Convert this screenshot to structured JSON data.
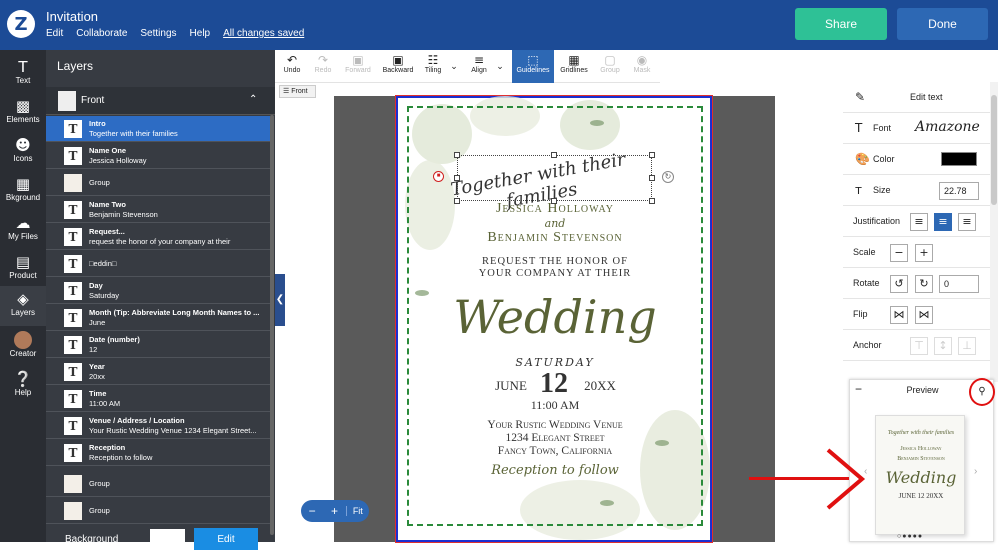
{
  "app": {
    "title": "Invitation",
    "menu": [
      "Edit",
      "Collaborate",
      "Settings",
      "Help"
    ],
    "saved_status": "All changes saved",
    "share_label": "Share",
    "done_label": "Done"
  },
  "leftnav": [
    {
      "label": "Text",
      "icon": "text-icon"
    },
    {
      "label": "Elements",
      "icon": "elements-icon"
    },
    {
      "label": "Icons",
      "icon": "smiley-icon"
    },
    {
      "label": "Bkground",
      "icon": "background-icon"
    },
    {
      "label": "My Files",
      "icon": "cloud-upload-icon"
    },
    {
      "label": "Product",
      "icon": "product-icon"
    },
    {
      "label": "Layers",
      "icon": "layers-icon"
    },
    {
      "label": "Creator",
      "icon": "avatar-icon"
    },
    {
      "label": "Help",
      "icon": "help-icon"
    }
  ],
  "layers_panel": {
    "title": "Layers",
    "front_label": "Front",
    "items": [
      {
        "name": "Intro",
        "sub": "Together with their families",
        "selected": true
      },
      {
        "name": "Name One",
        "sub": "Jessica Holloway"
      },
      {
        "name": "",
        "sub": "",
        "single": "Group"
      },
      {
        "name": "Name Two",
        "sub": "Benjamin Stevenson"
      },
      {
        "name": "Request...",
        "sub": "request the honor of your company at their"
      },
      {
        "name": "",
        "sub": "",
        "single": "□eddin□"
      },
      {
        "name": "Day",
        "sub": "Saturday"
      },
      {
        "name": "Month (Tip: Abbreviate Long Month Names to ...",
        "sub": "June"
      },
      {
        "name": "Date (number)",
        "sub": "12"
      },
      {
        "name": "Year",
        "sub": "20xx"
      },
      {
        "name": "Time",
        "sub": "11:00 AM"
      },
      {
        "name": "Venue / Address / Location",
        "sub": "Your Rustic Wedding Venue 1234 Elegant Street..."
      },
      {
        "name": "Reception",
        "sub": "Reception to follow"
      },
      {
        "name": "",
        "sub": "",
        "single": "Group"
      },
      {
        "name": "",
        "sub": "",
        "single": "Group"
      }
    ],
    "background_label": "Background",
    "edit_label": "Edit"
  },
  "toolbar": [
    {
      "label": "Undo",
      "icon": "undo-icon",
      "glyph": "↶"
    },
    {
      "label": "Redo",
      "icon": "redo-icon",
      "glyph": "↷",
      "disabled": true
    },
    {
      "label": "Forward",
      "icon": "forward-icon",
      "glyph": "▣",
      "disabled": true
    },
    {
      "label": "Backward",
      "icon": "backward-icon",
      "glyph": "▣"
    },
    {
      "label": "Tiling",
      "icon": "tiling-icon",
      "glyph": "☷"
    },
    {
      "label": "Align",
      "icon": "align-icon",
      "glyph": "≡"
    },
    {
      "label": "Guidelines",
      "icon": "guidelines-icon",
      "glyph": "⬚",
      "active": true
    },
    {
      "label": "Gridlines",
      "icon": "gridlines-icon",
      "glyph": "▦"
    },
    {
      "label": "Group",
      "icon": "group-icon",
      "glyph": "▢",
      "disabled": true
    },
    {
      "label": "Mask",
      "icon": "mask-icon",
      "glyph": "◉",
      "disabled": true
    }
  ],
  "front_tag": "Front",
  "card": {
    "intro": "Together with their families",
    "name_one": "Jessica Holloway",
    "and": "and",
    "name_two": "Benjamin Stevenson",
    "request_1": "Request the honor of",
    "request_2": "your company at their",
    "wedding": "Wedding",
    "day": "Saturday",
    "month": "June",
    "date": "12",
    "year": "20XX",
    "time": "11:00 AM",
    "venue_1": "Your Rustic Wedding Venue",
    "venue_2": "1234 Elegant Street",
    "venue_3": "Fancy Town, California",
    "reception": "Reception to follow"
  },
  "zoom": {
    "minus": "−",
    "plus": "+",
    "fit": "Fit"
  },
  "properties": {
    "edit_text": "Edit text",
    "font_label": "Font",
    "font_value": "Amazone",
    "color_label": "Color",
    "color_value": "#000000",
    "size_label": "Size",
    "size_value": "22.78",
    "justification_label": "Justification",
    "scale_label": "Scale",
    "rotate_label": "Rotate",
    "rotate_value": "0",
    "flip_label": "Flip",
    "anchor_label": "Anchor"
  },
  "preview": {
    "title": "Preview",
    "minimize": "−",
    "card_intro": "Together with their families",
    "card_name_one": "Jessica Holloway",
    "card_name_two": "Benjamin Stevenson",
    "card_wedding": "Wedding",
    "card_date": "JUNE 12 20XX"
  },
  "colors": {
    "topbar": "#1c4b96",
    "share": "#2ec196",
    "done": "#2d68b4",
    "selected_layer": "#2d6cc4",
    "card_text": "#5a6336",
    "annotation_red": "#e01010"
  }
}
